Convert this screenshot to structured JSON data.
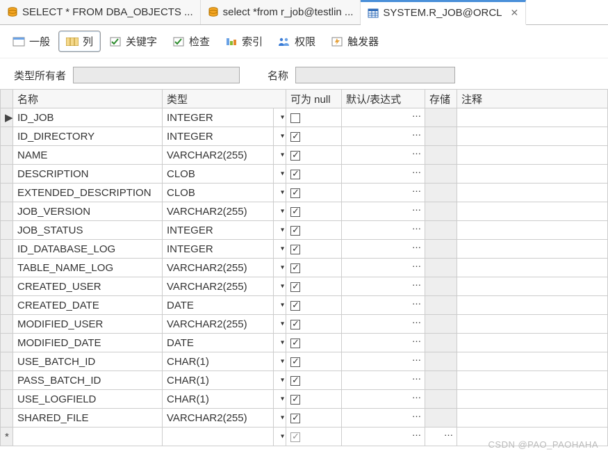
{
  "tabs": [
    {
      "label": "SELECT * FROM DBA_OBJECTS  ..."
    },
    {
      "label": "select *from r_job@testlin ..."
    },
    {
      "label": "SYSTEM.R_JOB@ORCL",
      "active": true,
      "closeable": true
    }
  ],
  "subtabs": {
    "general": "一般",
    "columns": "列",
    "keywords": "关键字",
    "check": "检查",
    "index": "索引",
    "perm": "权限",
    "trigger": "触发器"
  },
  "filter": {
    "owner_label": "类型所有者",
    "name_label": "名称",
    "owner_value": "",
    "name_value": ""
  },
  "headers": {
    "name": "名称",
    "type": "类型",
    "nullable": "可为 null",
    "defaultexpr": "默认/表达式",
    "storage": "存储",
    "comment": "注释"
  },
  "rows": [
    {
      "name": "ID_JOB",
      "type": "INTEGER",
      "nullable": false
    },
    {
      "name": "ID_DIRECTORY",
      "type": "INTEGER",
      "nullable": true
    },
    {
      "name": "NAME",
      "type": "VARCHAR2(255)",
      "nullable": true
    },
    {
      "name": "DESCRIPTION",
      "type": "CLOB",
      "nullable": true
    },
    {
      "name": "EXTENDED_DESCRIPTION",
      "type": "CLOB",
      "nullable": true
    },
    {
      "name": "JOB_VERSION",
      "type": "VARCHAR2(255)",
      "nullable": true
    },
    {
      "name": "JOB_STATUS",
      "type": "INTEGER",
      "nullable": true
    },
    {
      "name": "ID_DATABASE_LOG",
      "type": "INTEGER",
      "nullable": true
    },
    {
      "name": "TABLE_NAME_LOG",
      "type": "VARCHAR2(255)",
      "nullable": true
    },
    {
      "name": "CREATED_USER",
      "type": "VARCHAR2(255)",
      "nullable": true
    },
    {
      "name": "CREATED_DATE",
      "type": "DATE",
      "nullable": true
    },
    {
      "name": "MODIFIED_USER",
      "type": "VARCHAR2(255)",
      "nullable": true
    },
    {
      "name": "MODIFIED_DATE",
      "type": "DATE",
      "nullable": true
    },
    {
      "name": "USE_BATCH_ID",
      "type": "CHAR(1)",
      "nullable": true
    },
    {
      "name": "PASS_BATCH_ID",
      "type": "CHAR(1)",
      "nullable": true
    },
    {
      "name": "USE_LOGFIELD",
      "type": "CHAR(1)",
      "nullable": true
    },
    {
      "name": "SHARED_FILE",
      "type": "VARCHAR2(255)",
      "nullable": true
    }
  ],
  "watermark": "CSDN @PAO_PAOHAHA"
}
